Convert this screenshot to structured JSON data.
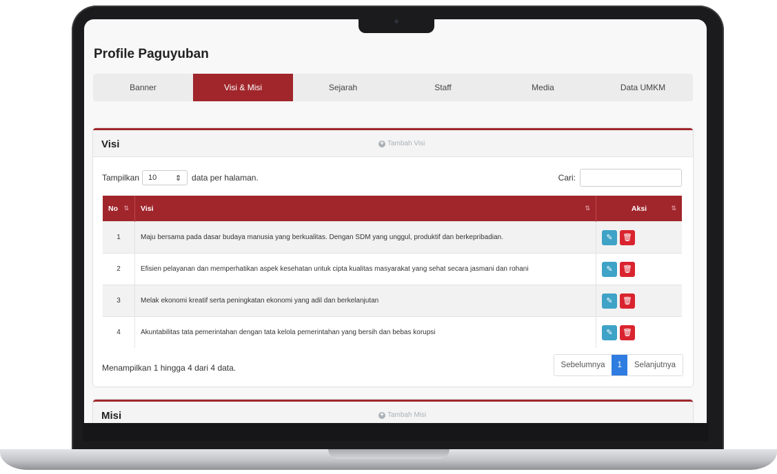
{
  "page_title": "Profile Paguyuban",
  "tabs": [
    {
      "label": "Banner"
    },
    {
      "label": "Visi & Misi"
    },
    {
      "label": "Sejarah"
    },
    {
      "label": "Staff"
    },
    {
      "label": "Media"
    },
    {
      "label": "Data UMKM"
    }
  ],
  "visi": {
    "title": "Visi",
    "add_label": "Tambah Visi",
    "show_label": "Tampilkan",
    "page_size": "10",
    "per_page_label": "data per halaman.",
    "search_label": "Cari:",
    "columns": {
      "no": "No",
      "visi": "Visi",
      "aksi": "Aksi"
    },
    "rows": [
      {
        "no": "1",
        "text": "Maju bersama pada dasar budaya manusia yang berkualitas. Dengan SDM yang unggul, produktif dan berkepribadian."
      },
      {
        "no": "2",
        "text": "Efisien pelayanan dan memperhatikan aspek kesehatan untuk cipta kualitas masyarakat yang sehat secara jasmani dan rohani"
      },
      {
        "no": "3",
        "text": "Melak ekonomi kreatif serta peningkatan ekonomi yang adil dan berkelanjutan"
      },
      {
        "no": "4",
        "text": "Akuntabilitas tata pemerintahan dengan tata kelola pemerintahan yang bersih dan bebas korupsi"
      }
    ],
    "info": "Menampilkan 1 hingga 4 dari 4 data.",
    "pager": {
      "prev": "Sebelumnya",
      "current": "1",
      "next": "Selanjutnya"
    }
  },
  "misi": {
    "title": "Misi",
    "add_label": "Tambah Misi"
  },
  "colors": {
    "accent": "#a0262b",
    "edit": "#3fa2c7",
    "delete": "#d9242f",
    "page_active": "#2f7de1"
  }
}
